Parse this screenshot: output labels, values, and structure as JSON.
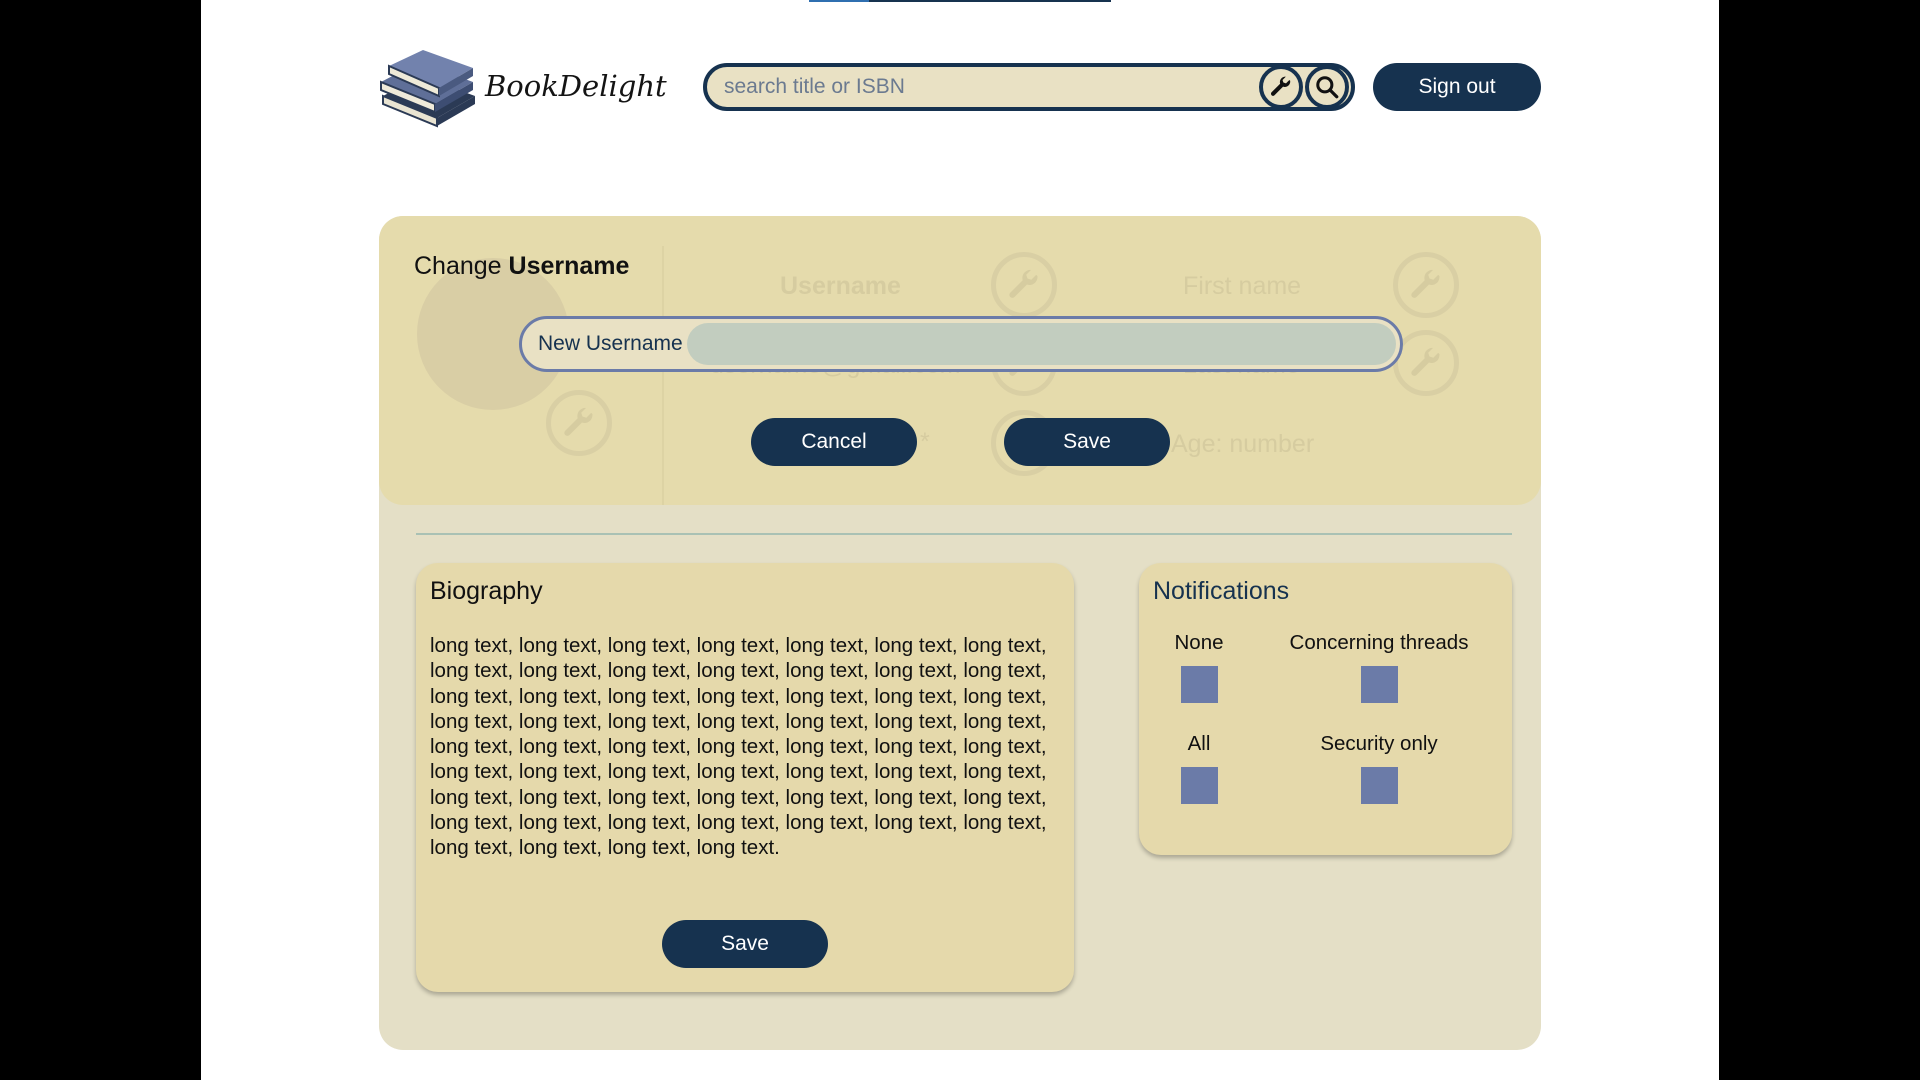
{
  "header": {
    "app_name": "BookDelight",
    "search": {
      "placeholder": "search title or ISBN",
      "value": ""
    },
    "sign_out_label": "Sign out"
  },
  "profile_background": {
    "username_label": "Username",
    "first_name_label": "First name",
    "email_placeholder": "username@gmail.com",
    "last_name_label": "Last name",
    "asterisk": "*",
    "age_label": "Age: number"
  },
  "change_username": {
    "title_prefix": "Change ",
    "title_bold": "Username",
    "field_label": "New Username",
    "field_value": "",
    "cancel_label": "Cancel",
    "save_label": "Save"
  },
  "biography": {
    "title": "Biography",
    "text": "long text, long text, long text, long text, long text, long text, long text, long text, long text, long text, long text, long text, long text, long text, long text, long text, long text, long text, long text, long text, long text, long text, long text, long text, long text, long text, long text, long text, long text, long text, long text, long text, long text, long text, long text, long text, long text, long text, long text, long text, long text, long text, long text, long text, long text, long text, long text, long text, long text, long text, long text, long text, long text, long text, long text, long text, long text, long text, long text, long text.",
    "save_label": "Save"
  },
  "notifications": {
    "title": "Notifications",
    "options": [
      {
        "label": "None"
      },
      {
        "label": "Concerning threads"
      },
      {
        "label": "All"
      },
      {
        "label": "Security only"
      }
    ]
  },
  "colors": {
    "navy": "#16324f",
    "card": "#e5dbac",
    "panel": "#e4dfc6",
    "checkbox": "#6b7ba8"
  }
}
